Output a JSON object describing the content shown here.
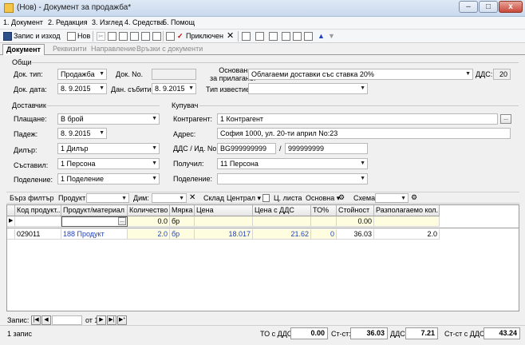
{
  "window": {
    "title": "(Нов) - Документ за продажба*"
  },
  "menu": [
    "1. Документ",
    "2. Редакция",
    "3. Изглед",
    "4. Средства",
    "5. Помощ"
  ],
  "toolbar": {
    "save_exit": "Запис и изход",
    "new": "Нов",
    "apply": "Приключен"
  },
  "tabs": [
    "Документ",
    "Реквизити",
    "Направление",
    "Връзки с документи"
  ],
  "general": {
    "section": "Общи",
    "doc_type_label": "Док. тип:",
    "doc_type": "Продажба",
    "doc_no_label": "Док. No.",
    "doc_no": "",
    "doc_date_label": "Док. дата:",
    "doc_date": "8. 9.2015",
    "tax_event_label": "Дан. събитие:",
    "tax_event": "8. 9.2015",
    "basis_label_1": "Основание",
    "basis_label_2": "за прилагане:",
    "basis": "Облагаеми доставки със ставка 20%",
    "vat_label": "ДДС:",
    "vat": "20",
    "notice_label": "Тип известие:",
    "notice": ""
  },
  "supplier": {
    "section": "Доставчик",
    "payment_label": "Плащане:",
    "payment": "В брой",
    "due_label": "Падеж:",
    "due": "8. 9.2015",
    "dealer_label": "Дилър:",
    "dealer": "1 Дилър",
    "composed_label": "Съставил:",
    "composed": "1 Персона",
    "division_label": "Поделение:",
    "division": "1 Поделение"
  },
  "buyer": {
    "section": "Купувач",
    "contractor_label": "Контрагент:",
    "contractor": "1 Контрагент",
    "address_label": "Адрес:",
    "address": "София 1000, ул. 20-ти април No:23",
    "vat_id_label": "ДДС / Ид. No.",
    "vat_no": "BG999999999",
    "id_no": "999999999",
    "slash": "/",
    "receiver_label": "Получил:",
    "receiver": "11 Персона",
    "division_label": "Поделение:",
    "division": ""
  },
  "filter": {
    "quick_label": "Бърз филтър",
    "product_label": "Продукт:",
    "dim_label": "Дим:",
    "warehouse_label": "Склад",
    "warehouse": "Централ",
    "price_list_label": "Ц. листа",
    "price_list": "Основна",
    "scheme_label": "Схема"
  },
  "grid": {
    "columns": [
      "Код продукт...",
      "Продукт/материал",
      "Количество",
      "Мярка",
      "Цена",
      "Цена с ДДС",
      "ТО%",
      "Стойност",
      "Разполагаемо кол."
    ],
    "new_row": [
      "",
      "",
      "0.0",
      "бр",
      "",
      "",
      "",
      "0.00",
      ""
    ],
    "rows": [
      [
        "029011",
        "188 Продукт",
        "2.0",
        "бр",
        "18.017",
        "21.62",
        "0",
        "36.03",
        "2.0"
      ]
    ]
  },
  "nav": {
    "label": "Запис:",
    "current": "",
    "of": "от 1"
  },
  "status": {
    "records": "1 запис",
    "to_vat_label": "ТО с ДДС:",
    "to_vat": "0.00",
    "value_label": "Ст-ст:",
    "value": "36.03",
    "vat_label": "ДДС:",
    "vat": "7.21",
    "value_vat_label": "Ст-ст с ДДС:",
    "value_vat": "43.24"
  }
}
